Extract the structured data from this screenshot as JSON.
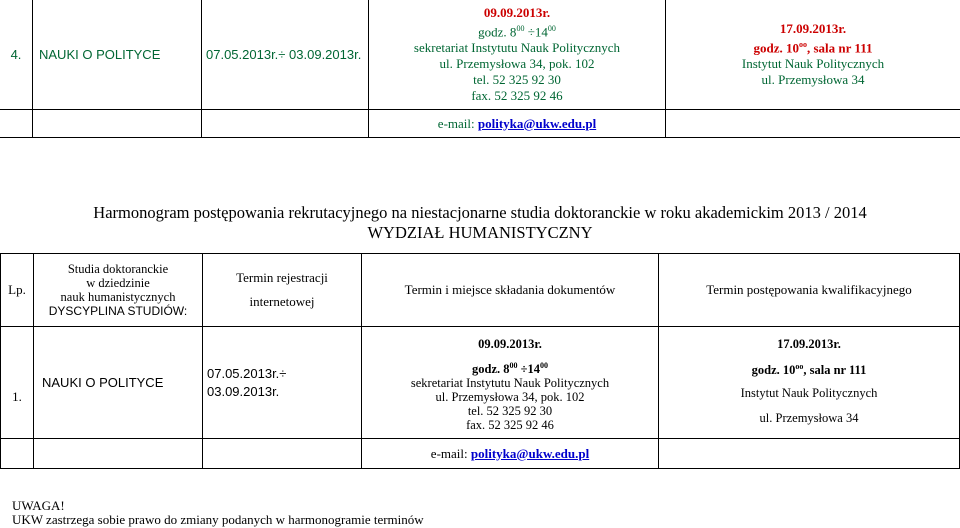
{
  "top_table": {
    "lp": "4.",
    "discipline": "NAUKI O POLITYCE",
    "registration": "07.05.2013r.÷ 03.09.2013r.",
    "documents": {
      "date": "09.09.2013r.",
      "time_prefix": "godz. 8",
      "time_sup1": "00",
      "time_mid": " ÷14",
      "time_sup2": "00",
      "line1": "sekretariat Instytutu Nauk Politycznych",
      "line2": "ul. Przemysłowa 34, pok. 102",
      "line3": "tel. 52 325 92 30",
      "line4": "fax. 52 325 92 46"
    },
    "qualification": {
      "date": "17.09.2013r.",
      "time_prefix": "godz. 10",
      "time_sup": "oo",
      "time_rest": ", sala nr 111",
      "line1": "Instytut Nauk Politycznych",
      "line2": "ul. Przemysłowa 34"
    },
    "email_label": "e-mail: ",
    "email": "polityka@ukw.edu.pl"
  },
  "heading": {
    "title": "Harmonogram postępowania rekrutacyjnego na niestacjonarne studia doktoranckie w roku akademickim 2013 / 2014",
    "faculty": "WYDZIAŁ HUMANISTYCZNY"
  },
  "main_table": {
    "headers": {
      "lp": "Lp.",
      "studies_line1": "Studia doktoranckie",
      "studies_line2": "w dziedzinie",
      "studies_line3": "nauk humanistycznych",
      "studies_line4": "DYSCYPLINA STUDIÓW:",
      "registration_line1": "Termin rejestracji",
      "registration_line2": "internetowej",
      "documents": "Termin i miejsce składania dokumentów",
      "qualification": "Termin postępowania kwalifikacyjnego"
    },
    "row": {
      "lp": "1.",
      "discipline": "NAUKI O POLITYCE",
      "registration": "07.05.2013r.÷ 03.09.2013r.",
      "documents": {
        "date": "09.09.2013r.",
        "time_prefix": "godz. 8",
        "time_sup1": "00",
        "time_mid": " ÷14",
        "time_sup2": "00",
        "line1": "sekretariat Instytutu Nauk Politycznych",
        "line2": "ul. Przemysłowa 34, pok. 102",
        "line3": "tel. 52 325 92 30",
        "line4": "fax. 52 325 92 46"
      },
      "qualification": {
        "date": "17.09.2013r.",
        "time_prefix": "godz. 10",
        "time_sup": "oo",
        "time_rest": ", sala nr 111",
        "line1": "Instytut Nauk Politycznych",
        "line2": "ul. Przemysłowa 34"
      },
      "email_label": "e-mail: ",
      "email": "polityka@ukw.edu.pl"
    }
  },
  "footer": {
    "warning": "UWAGA!",
    "note": "UKW zastrzega sobie prawo do zmiany podanych w harmonogramie terminów"
  },
  "colors": {
    "top_text": "#006633",
    "emphasis": "#cc0000",
    "link": "#0000cc"
  }
}
